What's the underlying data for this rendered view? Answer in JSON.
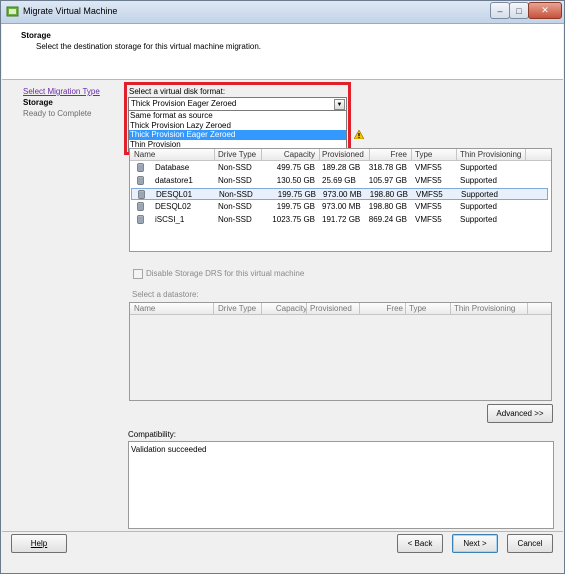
{
  "window": {
    "title": "Migrate Virtual Machine"
  },
  "header": {
    "title": "Storage",
    "subtitle": "Select the destination storage for this virtual machine migration."
  },
  "nav": {
    "items": [
      {
        "label": "Select Migration Type"
      },
      {
        "label": "Storage"
      },
      {
        "label": "Ready to Complete"
      }
    ]
  },
  "disk_format": {
    "label": "Select a virtual disk format:",
    "selected": "Thick Provision Eager Zeroed",
    "options": [
      "Same format as source",
      "Thick Provision Lazy Zeroed",
      "Thick Provision Eager Zeroed",
      "Thin Provision"
    ]
  },
  "datastore_table": {
    "columns": [
      "Name",
      "Drive Type",
      "Capacity",
      "Provisioned",
      "Free",
      "Type",
      "Thin Provisioning"
    ],
    "rows": [
      {
        "name": "Database",
        "drive": "Non-SSD",
        "capacity": "499.75 GB",
        "provisioned": "189.28 GB",
        "free": "318.78 GB",
        "type": "VMFS5",
        "thin": "Supported"
      },
      {
        "name": "datastore1",
        "drive": "Non-SSD",
        "capacity": "130.50 GB",
        "provisioned": "25.69 GB",
        "free": "105.97 GB",
        "type": "VMFS5",
        "thin": "Supported"
      },
      {
        "name": "DESQL01",
        "drive": "Non-SSD",
        "capacity": "199.75 GB",
        "provisioned": "973.00 MB",
        "free": "198.80 GB",
        "type": "VMFS5",
        "thin": "Supported"
      },
      {
        "name": "DESQL02",
        "drive": "Non-SSD",
        "capacity": "199.75 GB",
        "provisioned": "973.00 MB",
        "free": "198.80 GB",
        "type": "VMFS5",
        "thin": "Supported"
      },
      {
        "name": "iSCSI_1",
        "drive": "Non-SSD",
        "capacity": "1023.75 GB",
        "provisioned": "191.72 GB",
        "free": "869.24 GB",
        "type": "VMFS5",
        "thin": "Supported"
      }
    ]
  },
  "storage_drs": {
    "label": "Disable Storage DRS for this virtual machine"
  },
  "select_datastore": {
    "label": "Select a datastore:",
    "columns": [
      "Name",
      "Drive Type",
      "Capacity",
      "Provisioned",
      "Free",
      "Type",
      "Thin Provisioning"
    ]
  },
  "buttons": {
    "advanced": "Advanced >>",
    "help": "Help",
    "back": "< Back",
    "next": "Next >",
    "cancel": "Cancel"
  },
  "compatibility": {
    "label": "Compatibility:",
    "message": "Validation succeeded"
  },
  "colors": {
    "highlight": "#3399ff",
    "annotation_box": "#e0202a",
    "link": "#6a2ca8"
  }
}
